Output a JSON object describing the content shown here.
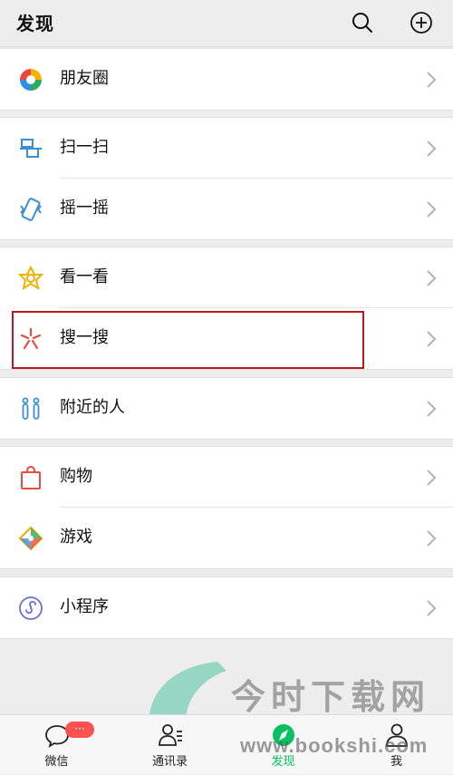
{
  "header": {
    "title": "发现"
  },
  "groups": {
    "g1": [
      {
        "label": "朋友圈"
      }
    ],
    "g2": [
      {
        "label": "扫一扫"
      },
      {
        "label": "摇一摇"
      }
    ],
    "g3": [
      {
        "label": "看一看"
      },
      {
        "label": "搜一搜"
      }
    ],
    "g4": [
      {
        "label": "附近的人"
      }
    ],
    "g5": [
      {
        "label": "购物"
      },
      {
        "label": "游戏"
      }
    ],
    "g6": [
      {
        "label": "小程序"
      }
    ]
  },
  "tabs": [
    {
      "label": "微信",
      "badge": "···"
    },
    {
      "label": "通讯录"
    },
    {
      "label": "发现",
      "active": true
    },
    {
      "label": "我"
    }
  ],
  "watermark": {
    "text": "今时下载网",
    "url": "www.bookshi.com"
  },
  "colors": {
    "accent_green": "#07c160",
    "highlight_red": "#c0161e",
    "badge_red": "#fa5151"
  }
}
